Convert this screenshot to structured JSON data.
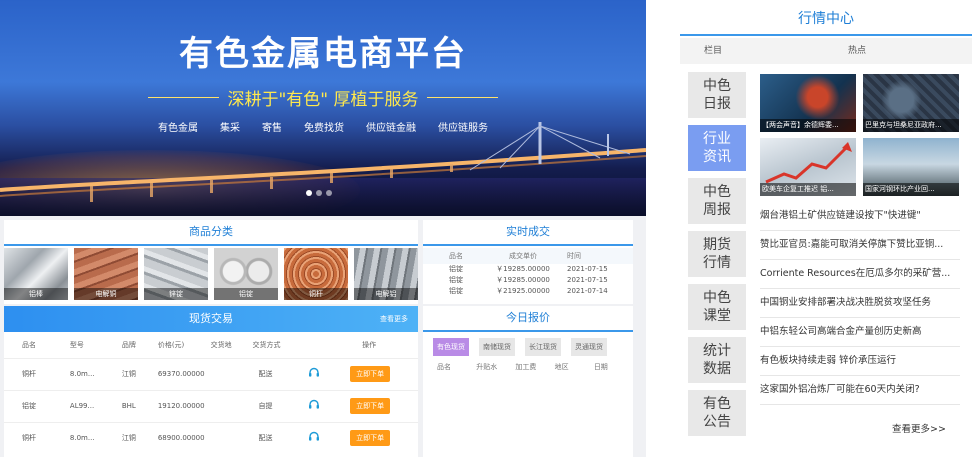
{
  "banner": {
    "title": "有色金属电商平台",
    "subtitle": "深耕于\"有色\"   厚植于服务",
    "nav": [
      "有色金属",
      "集采",
      "寄售",
      "免费找货",
      "供应链金融",
      "供应链服务"
    ]
  },
  "categories": {
    "title": "商品分类",
    "items": [
      "铝棒",
      "电解铜",
      "锌锭",
      "铝锭",
      "铜杆",
      "电解铝"
    ]
  },
  "realtime": {
    "title": "实时成交",
    "headers": [
      "品名",
      "成交单价",
      "时间"
    ],
    "rows": [
      {
        "name": "铝锭",
        "price": "￥19285.00000",
        "time": "2021-07-15"
      },
      {
        "name": "铝锭",
        "price": "￥19285.00000",
        "time": "2021-07-15"
      },
      {
        "name": "铝锭",
        "price": "￥21925.00000",
        "time": "2021-07-14"
      }
    ]
  },
  "spot": {
    "title": "现货交易",
    "more": "查看更多",
    "headers": [
      "品名",
      "型号",
      "品牌",
      "价格(元)",
      "交货地",
      "交货方式",
      "",
      "操作"
    ],
    "rows": [
      {
        "name": "铜杆",
        "model": "8.0m...",
        "brand": "江铜",
        "price": "69370.00000",
        "place": "",
        "method": "配送",
        "action": "立即下单"
      },
      {
        "name": "铝锭",
        "model": "AL99...",
        "brand": "BHL",
        "price": "19120.00000",
        "place": "",
        "method": "自提",
        "action": "立即下单"
      },
      {
        "name": "铜杆",
        "model": "8.0m...",
        "brand": "江铜",
        "price": "68900.00000",
        "place": "",
        "method": "配送",
        "action": "立即下单"
      }
    ]
  },
  "quote": {
    "title": "今日报价",
    "tabs": [
      "有色现货",
      "南储现货",
      "长江现货",
      "灵通现货"
    ],
    "columns": [
      "品名",
      "升贴水",
      "加工费",
      "地区",
      "日期"
    ]
  },
  "market": {
    "title": "行情中心",
    "col_label": "栏目",
    "hot_label": "热点",
    "categories": [
      "中色日报",
      "行业资讯",
      "中色周报",
      "期货行情",
      "中色课堂",
      "统计数据",
      "有色公告"
    ],
    "active_index": 1,
    "thumbs": [
      "【两会声音】余德辉委...",
      "巴里克与坦桑尼亚政府...",
      "欧美车企复工推迟 铝...",
      "国家河钢环比产业回..."
    ],
    "news": [
      "烟台港铝土矿供应链建设按下\"快进键\"",
      "赞比亚官员:嘉能可取消关停旗下赞比亚铜...",
      "Corriente Resources在厄瓜多尔的采矿营...",
      "中国铜业安排部署决战决胜脱贫攻坚任务",
      "中铝东轻公司高端合金产量创历史新高",
      "有色板块持续走弱 锌价承压运行",
      "这家国外铝冶炼厂可能在60天内关闭?"
    ],
    "more": "查看更多>>"
  }
}
